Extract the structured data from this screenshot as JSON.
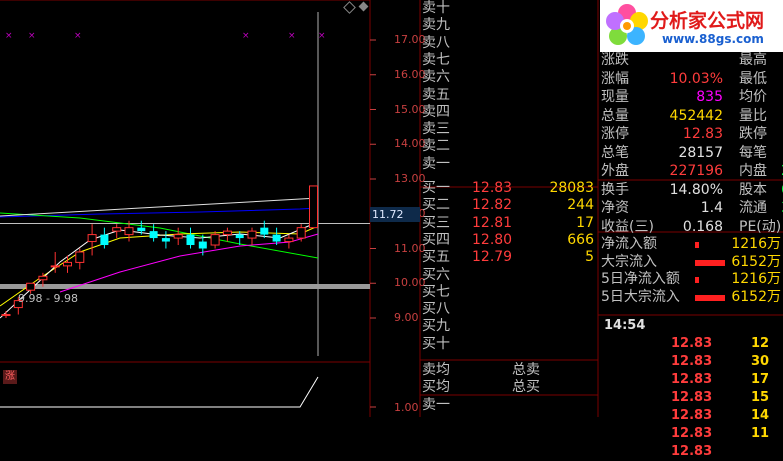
{
  "logo": {
    "title": "分析家公式网",
    "url": "www.88gs.com"
  },
  "chart": {
    "y_labels": [
      "17.00",
      "16.00",
      "15.00",
      "14.00",
      "13.00",
      "12.00",
      "11.00",
      "10.00",
      "9.00"
    ],
    "current_price_tag": "11.72",
    "low_label": "9.98 - 9.98",
    "limit_icon": "涨",
    "sub_y_label": "1.00",
    "colors": {
      "up": "#ff3232",
      "down": "#00ffff",
      "ma5": "#ffffff",
      "ma10": "#ffff00",
      "ma20": "#ff00ff",
      "ma60": "#00ff00",
      "ma120": "#0000ff"
    }
  },
  "chart_data": {
    "type": "candlestick",
    "y_range": [
      8.6,
      17.4
    ],
    "candles": [
      {
        "o": 9.1,
        "h": 9.2,
        "l": 9.0,
        "c": 9.1
      },
      {
        "o": 9.3,
        "h": 9.6,
        "l": 9.1,
        "c": 9.5
      },
      {
        "o": 9.8,
        "h": 10.0,
        "l": 9.7,
        "c": 10.0
      },
      {
        "o": 10.1,
        "h": 10.3,
        "l": 9.9,
        "c": 10.2
      },
      {
        "o": 10.5,
        "h": 10.9,
        "l": 10.3,
        "c": 10.5
      },
      {
        "o": 10.5,
        "h": 10.8,
        "l": 10.3,
        "c": 10.6
      },
      {
        "o": 10.6,
        "h": 11.0,
        "l": 10.4,
        "c": 10.9
      },
      {
        "o": 11.2,
        "h": 11.7,
        "l": 10.8,
        "c": 11.4
      },
      {
        "o": 11.4,
        "h": 11.6,
        "l": 11.0,
        "c": 11.1
      },
      {
        "o": 11.5,
        "h": 11.7,
        "l": 11.3,
        "c": 11.6
      },
      {
        "o": 11.4,
        "h": 11.8,
        "l": 11.2,
        "c": 11.6
      },
      {
        "o": 11.6,
        "h": 11.8,
        "l": 11.4,
        "c": 11.5
      },
      {
        "o": 11.5,
        "h": 11.7,
        "l": 11.2,
        "c": 11.3
      },
      {
        "o": 11.3,
        "h": 11.5,
        "l": 11.0,
        "c": 11.2
      },
      {
        "o": 11.3,
        "h": 11.6,
        "l": 11.1,
        "c": 11.4
      },
      {
        "o": 11.4,
        "h": 11.6,
        "l": 11.0,
        "c": 11.1
      },
      {
        "o": 11.2,
        "h": 11.4,
        "l": 10.8,
        "c": 11.0
      },
      {
        "o": 11.1,
        "h": 11.5,
        "l": 11.0,
        "c": 11.4
      },
      {
        "o": 11.4,
        "h": 11.6,
        "l": 11.2,
        "c": 11.5
      },
      {
        "o": 11.4,
        "h": 11.5,
        "l": 11.1,
        "c": 11.3
      },
      {
        "o": 11.3,
        "h": 11.6,
        "l": 11.1,
        "c": 11.5
      },
      {
        "o": 11.6,
        "h": 11.8,
        "l": 11.3,
        "c": 11.4
      },
      {
        "o": 11.4,
        "h": 11.6,
        "l": 11.1,
        "c": 11.2
      },
      {
        "o": 11.2,
        "h": 11.4,
        "l": 11.0,
        "c": 11.3
      },
      {
        "o": 11.3,
        "h": 11.7,
        "l": 11.2,
        "c": 11.6
      },
      {
        "o": 11.6,
        "h": 12.8,
        "l": 11.6,
        "c": 12.8
      }
    ]
  },
  "order_book": {
    "sells": [
      {
        "label": "卖十",
        "price": "",
        "vol": ""
      },
      {
        "label": "卖九",
        "price": "",
        "vol": ""
      },
      {
        "label": "卖八",
        "price": "",
        "vol": ""
      },
      {
        "label": "卖七",
        "price": "",
        "vol": ""
      },
      {
        "label": "卖六",
        "price": "",
        "vol": ""
      },
      {
        "label": "卖五",
        "price": "",
        "vol": ""
      },
      {
        "label": "卖四",
        "price": "",
        "vol": ""
      },
      {
        "label": "卖三",
        "price": "",
        "vol": ""
      },
      {
        "label": "卖二",
        "price": "",
        "vol": ""
      },
      {
        "label": "卖一",
        "price": "",
        "vol": ""
      }
    ],
    "buys": [
      {
        "label": "买一",
        "price": "12.83",
        "vol": "28083"
      },
      {
        "label": "买二",
        "price": "12.82",
        "vol": "244"
      },
      {
        "label": "买三",
        "price": "12.81",
        "vol": "17"
      },
      {
        "label": "买四",
        "price": "12.80",
        "vol": "666"
      },
      {
        "label": "买五",
        "price": "12.79",
        "vol": "5"
      },
      {
        "label": "买六",
        "price": "",
        "vol": ""
      },
      {
        "label": "买七",
        "price": "",
        "vol": ""
      },
      {
        "label": "买八",
        "price": "",
        "vol": ""
      },
      {
        "label": "买九",
        "price": "",
        "vol": ""
      },
      {
        "label": "买十",
        "price": "",
        "vol": ""
      }
    ],
    "footer": [
      {
        "label": "卖均",
        "right": "总卖"
      },
      {
        "label": "买均",
        "right": "总买"
      },
      {
        "label": "卖一",
        "right": ""
      }
    ]
  },
  "stats": [
    {
      "l": "涨跌",
      "v": "",
      "r": "最高",
      "x": ""
    },
    {
      "l": "涨幅",
      "v": "10.03%",
      "r": "最低",
      "x": ""
    },
    {
      "l": "现量",
      "v": "835",
      "r": "均价",
      "x": ""
    },
    {
      "l": "总量",
      "v": "452442",
      "r": "量比",
      "x": ""
    },
    {
      "l": "涨停",
      "v": "12.83",
      "r": "跌停",
      "x": ""
    },
    {
      "l": "总笔",
      "v": "28157",
      "r": "每笔",
      "x": ""
    },
    {
      "l": "外盘",
      "v": "227196",
      "r": "内盘",
      "x": "2"
    },
    {
      "l": "换手",
      "v": "14.80%",
      "r": "股本",
      "x": "6"
    },
    {
      "l": "净资",
      "v": "1.4",
      "r": "流通",
      "x": "3"
    },
    {
      "l": "收益(三)",
      "v": "0.168",
      "r": "PE(动)",
      "x": ""
    }
  ],
  "flows": [
    {
      "label": "净流入额",
      "value": "1216万"
    },
    {
      "label": "大宗流入",
      "value": "6152万"
    },
    {
      "label": "5日净流入额",
      "value": "1216万"
    },
    {
      "label": "5日大宗流入",
      "value": "6152万"
    }
  ],
  "ticks": {
    "time": "14:54",
    "rows": [
      {
        "price": "12.83",
        "vol": "12"
      },
      {
        "price": "12.83",
        "vol": "30"
      },
      {
        "price": "12.83",
        "vol": "17"
      },
      {
        "price": "12.83",
        "vol": "15"
      },
      {
        "price": "12.83",
        "vol": "14"
      },
      {
        "price": "12.83",
        "vol": "11"
      },
      {
        "price": "12.83",
        "vol": ""
      }
    ]
  }
}
